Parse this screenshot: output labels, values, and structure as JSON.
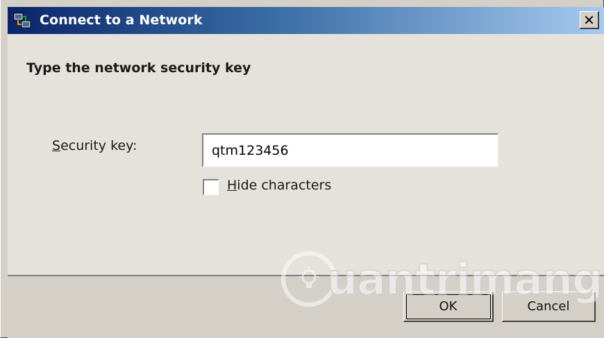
{
  "window": {
    "title": "Connect to a Network",
    "close_glyph": "✕"
  },
  "content": {
    "heading": "Type the network security key",
    "security_key_label": "Security key:",
    "security_key_value": "qtm123456",
    "hide_characters_label": "Hide characters",
    "hide_characters_checked": false
  },
  "buttons": {
    "ok_label": "OK",
    "cancel_label": "Cancel"
  },
  "watermark": {
    "text": "uantrimang",
    "brand_letter": "Q"
  },
  "colors": {
    "title_start": "#0a246a",
    "title_end": "#a6caf0",
    "face": "#d4d0c8"
  }
}
